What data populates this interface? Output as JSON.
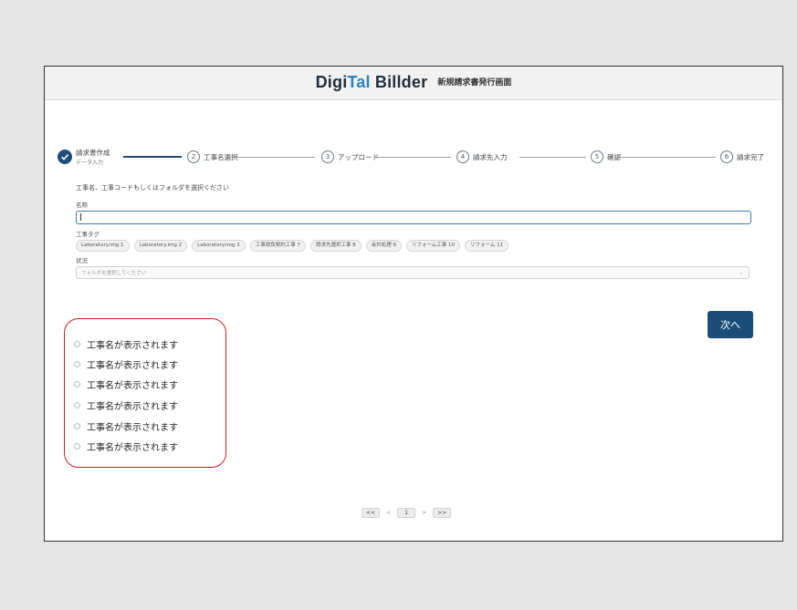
{
  "header": {
    "logo_part1": "Digi",
    "logo_part2": "Tal",
    "logo_part3": " Billder",
    "subtitle": "新規請求書発行画面"
  },
  "stepper": {
    "steps": [
      {
        "number": "1",
        "label": "請求書作成",
        "sublabel": "データ入力"
      },
      {
        "number": "2",
        "label": "工事名選択"
      },
      {
        "number": "3",
        "label": "アップロード"
      },
      {
        "number": "4",
        "label": "請求先入力"
      },
      {
        "number": "5",
        "label": "確認"
      },
      {
        "number": "6",
        "label": "請求完了"
      }
    ]
  },
  "form": {
    "instruction": "工事名、工事コードもしくはフォルダを選択ください",
    "name_label": "名称",
    "tag_label": "工事タグ",
    "tags": [
      "Laboratory.img 1",
      "Laboratory.img 2",
      "Laboratory.img 3",
      "工事請負契約工事 7",
      "請求先選択工事 8",
      "会計処理 9",
      "リフォーム工事 10",
      "リフォーム 11"
    ],
    "folder_label": "状況",
    "folder_placeholder": "フォルダを選択してください"
  },
  "next_button": "次へ",
  "project_list": [
    "工事名が表示されます",
    "工事名が表示されます",
    "工事名が表示されます",
    "工事名が表示されます",
    "工事名が表示されます",
    "工事名が表示されます"
  ],
  "pagination": {
    "first": "<<",
    "prev": "<",
    "current": "1",
    "next": ">",
    "last": ">>"
  },
  "colors": {
    "primary": "#1c4d78",
    "highlight": "#d01e1e",
    "logo_accent": "#2d82b8",
    "input_focus": "#3a7ab8"
  }
}
